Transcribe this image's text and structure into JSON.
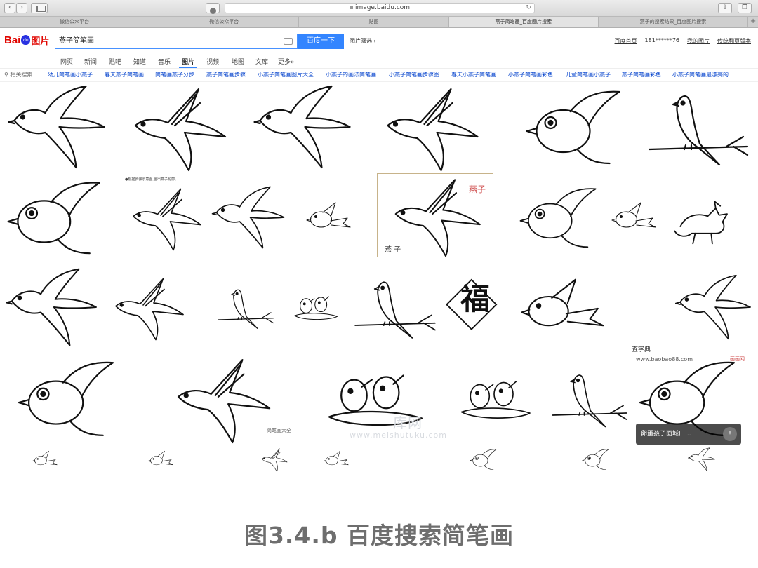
{
  "browser": {
    "url": "image.baidu.com",
    "tabs": [
      "微信公众平台",
      "微信公众平台",
      "贴图",
      "燕子简笔画_百度图片搜索",
      "燕子的搜索结果_百度图片搜索"
    ],
    "active_tab": 3
  },
  "search": {
    "logo_left": "Bai",
    "logo_paw": "du",
    "logo_right": "图片",
    "query": "燕子简笔画",
    "button": "百度一下",
    "filter": "图片筛选",
    "right_links": [
      "百度首页",
      "181******76",
      "我的图片",
      "传统翻页版本"
    ]
  },
  "nav": {
    "items": [
      "网页",
      "新闻",
      "贴吧",
      "知道",
      "音乐",
      "图片",
      "视频",
      "地图",
      "文库",
      "更多»"
    ],
    "active": 5
  },
  "related": {
    "label": "相关搜索:",
    "keywords": [
      "幼儿简笔画小燕子",
      "春天燕子简笔画",
      "简笔画燕子分步",
      "燕子简笔画步骤",
      "小燕子简笔画图片大全",
      "小燕子的画法简笔画",
      "小燕子简笔画步骤图",
      "春天小燕子简笔画",
      "小燕子简笔画彩色",
      "儿童简笔画小燕子",
      "燕子简笔画彩色",
      "小燕子简笔画最漂亮的"
    ]
  },
  "results": {
    "card_label_1": "燕子",
    "card_label_2": "燕 子",
    "fu": "福",
    "watermark_1": "www.baobao88.com",
    "watermark_2": "画画网",
    "watermark_3": "查字典",
    "watermark_4": "库网",
    "watermark_5": "www.meishutuku.com",
    "watermark_6": "简笔画大全",
    "note_line": "●根据步骤示意图,画出燕子轮廓。",
    "overlay_text": "卵蛋孩子面城口...",
    "overlay_icon": "!"
  },
  "caption": "图3.4.b  百度搜索简笔画"
}
